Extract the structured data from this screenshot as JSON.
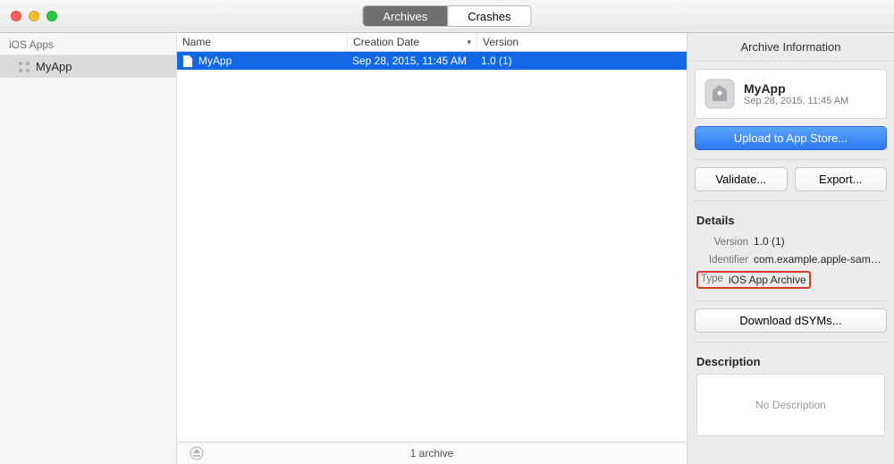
{
  "tabs": [
    "Archives",
    "Crashes"
  ],
  "sidebar": {
    "section": "iOS Apps",
    "items": [
      "MyApp"
    ]
  },
  "columns": [
    "Name",
    "Creation Date",
    "Version"
  ],
  "archives": [
    {
      "name": "MyApp",
      "creation_date": "Sep 28, 2015, 11:45 AM",
      "version": "1.0 (1)"
    }
  ],
  "status": {
    "count_text": "1 archive"
  },
  "info": {
    "title": "Archive Information",
    "app_name": "MyApp",
    "app_date": "Sep 28, 2015, 11:45 AM",
    "buttons": {
      "upload": "Upload to App Store...",
      "validate": "Validate...",
      "export": "Export...",
      "dsyms": "Download dSYMs..."
    },
    "details_heading": "Details",
    "details": [
      {
        "k": "Version",
        "v": "1.0 (1)"
      },
      {
        "k": "Identifier",
        "v": "com.example.apple-sam…"
      },
      {
        "k": "Type",
        "v": "iOS App Archive"
      }
    ],
    "description_heading": "Description",
    "description_placeholder": "No Description"
  }
}
